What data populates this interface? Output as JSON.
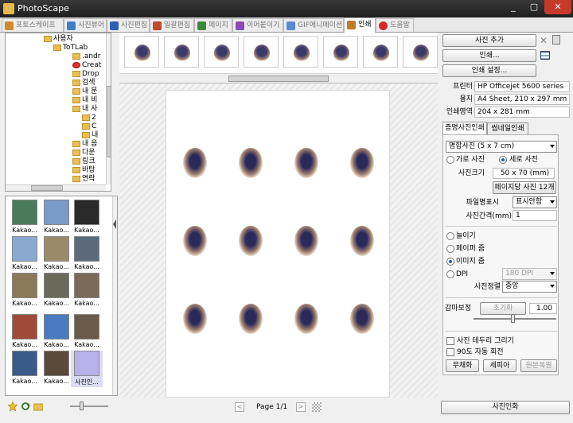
{
  "window": {
    "title": "PhotoScape",
    "minimize": "_",
    "maximize": "▢",
    "close": "✕"
  },
  "tabs": [
    {
      "label": "포토스케이프",
      "color": "#d08a2a"
    },
    {
      "label": "사진뷰어",
      "color": "#3a7fc8"
    },
    {
      "label": "사진편집",
      "color": "#2e5fb4"
    },
    {
      "label": "일괄편집",
      "color": "#c0492c"
    },
    {
      "label": "페이지",
      "color": "#3a8a3a"
    },
    {
      "label": "이어붙이기",
      "color": "#8a4ab4"
    },
    {
      "label": "GIF애니메이션",
      "color": "#5a8ad0"
    },
    {
      "label": "인쇄",
      "color": "#c07a2a"
    },
    {
      "label": "도움말",
      "color": "#d02a2a"
    }
  ],
  "tree": [
    {
      "label": "사용자"
    },
    {
      "label": "ToTLab"
    },
    {
      "label": ".andr"
    },
    {
      "label": "Creat"
    },
    {
      "label": "Drop"
    },
    {
      "label": "검색"
    },
    {
      "label": "내 문"
    },
    {
      "label": "내 비"
    },
    {
      "label": "내 사"
    },
    {
      "label": "2"
    },
    {
      "label": "C"
    },
    {
      "label": "내"
    },
    {
      "label": "내 음"
    },
    {
      "label": "다운"
    },
    {
      "label": "링크"
    },
    {
      "label": "바탕"
    },
    {
      "label": "연락"
    }
  ],
  "thumbnails": [
    {
      "caption": "Kakao...",
      "color": "#4a7a5a"
    },
    {
      "caption": "Kakao...",
      "color": "#7a9ac8"
    },
    {
      "caption": "Kakao...",
      "color": "#2a2a2a"
    },
    {
      "caption": "Kakao...",
      "color": "#8aa8d0"
    },
    {
      "caption": "Kakao...",
      "color": "#9a8a6a"
    },
    {
      "caption": "Kakao...",
      "color": "#5a6a7a"
    },
    {
      "caption": "Kakao...",
      "color": "#8a7a5a"
    },
    {
      "caption": "Kakao...",
      "color": "#6a6a5a"
    },
    {
      "caption": "Kakao...",
      "color": "#7a6a5a"
    },
    {
      "caption": "Kakao...",
      "color": "#a04a3a"
    },
    {
      "caption": "Kakao...",
      "color": "#4a7ac0"
    },
    {
      "caption": "Kakao...",
      "color": "#6a5a4a"
    },
    {
      "caption": "Kakao...",
      "color": "#3a5a8a"
    },
    {
      "caption": "Kakao...",
      "color": "#5a4a3a"
    },
    {
      "caption": "사진인...",
      "color": "#b8b0e8"
    }
  ],
  "pagenav": {
    "prev": "<",
    "page_label": "Page 1/1",
    "next": ">"
  },
  "right": {
    "add_photo": "사진 추가",
    "print": "인쇄...",
    "print_settings": "인쇄 설정...",
    "printer_label": "프린터",
    "printer_value": "HP Officejet 5600 series",
    "paper_label": "용지",
    "paper_value": "A4 Sheet, 210 x 297 mm",
    "area_label": "인쇄영역",
    "area_value": "204 x 281 mm",
    "tab_id": "증명사진인쇄",
    "tab_thumb": "썸네일인쇄",
    "photo_size_select": "명함사진 (5 x 7 cm)",
    "landscape": "가로 사진",
    "portrait": "세로 사진",
    "size_label": "사진크기",
    "size_value": "50 x 70 (mm)",
    "per_page": "페이지당 사진 12개",
    "filename_label": "파일명표시",
    "filename_value": "표시안함",
    "gap_label": "사진간격(mm)",
    "gap_value": "1",
    "opt_stretch": "늘이기",
    "opt_paper_zoom": "페이퍼 줌",
    "opt_image_zoom": "이미지 줌",
    "opt_dpi": "DPI",
    "dpi_value": "180 DPI",
    "align_label": "사진정렬",
    "align_value": "중앙",
    "gamma_label": "감마보정",
    "gamma_reset": "초기화",
    "gamma_value": "1.00",
    "draw_border": "사진 테두리 그리기",
    "auto_rotate": "90도 자동 회전",
    "btn_none": "무채화",
    "btn_sepia": "세피아",
    "btn_restore": "원본복원",
    "print_photo": "사진인화"
  }
}
